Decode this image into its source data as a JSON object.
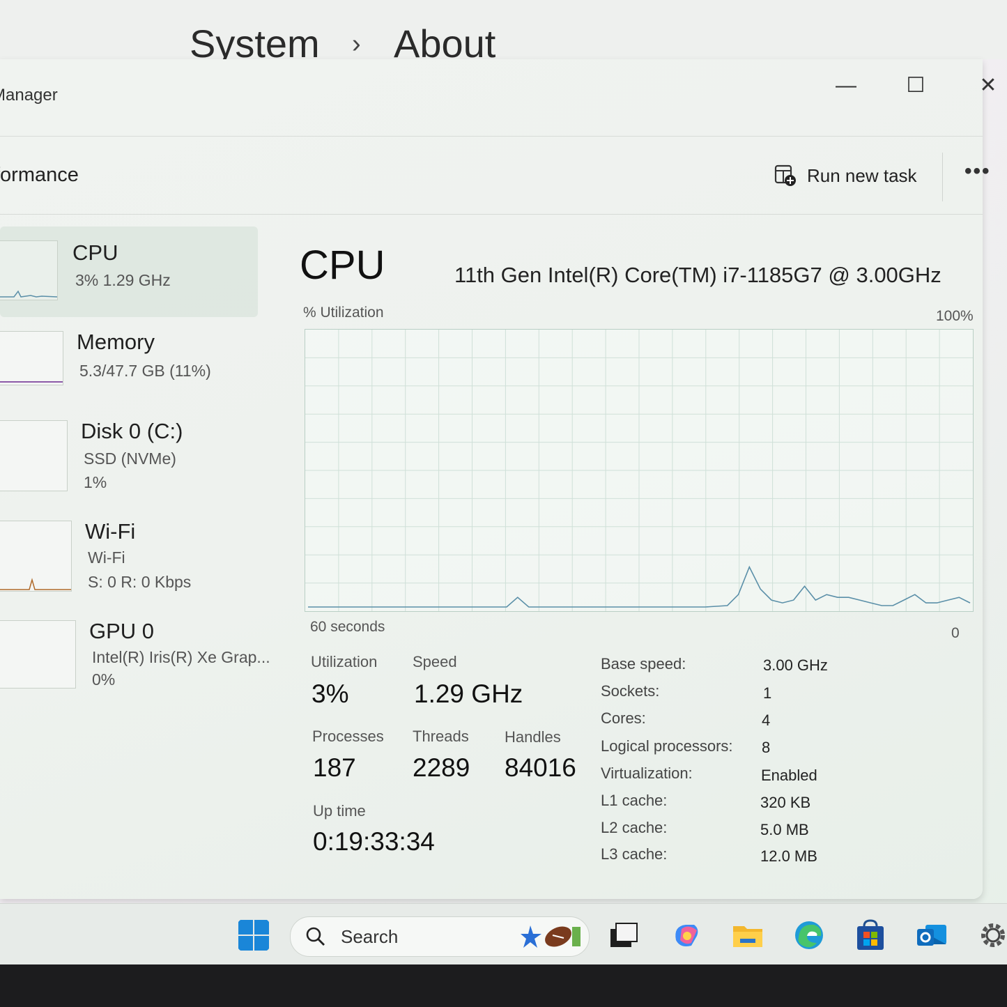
{
  "settings": {
    "breadcrumb_parent": "System",
    "breadcrumb_sep": "›",
    "breadcrumb_current": "About"
  },
  "window": {
    "title": "Manager",
    "controls": {
      "minimize": "—",
      "maximize": "☐",
      "close": "✕"
    }
  },
  "toolbar": {
    "page": "formance",
    "run_new_task": "Run new task",
    "more": "•••"
  },
  "sidebar": {
    "items": [
      {
        "name": "CPU",
        "sub1": "3%  1.29 GHz",
        "sub2": ""
      },
      {
        "name": "Memory",
        "sub1": "5.3/47.7 GB (11%)",
        "sub2": ""
      },
      {
        "name": "Disk 0 (C:)",
        "sub1": "SSD (NVMe)",
        "sub2": "1%"
      },
      {
        "name": "Wi-Fi",
        "sub1": "Wi-Fi",
        "sub2": "S: 0  R: 0 Kbps"
      },
      {
        "name": "GPU 0",
        "sub1": "Intel(R) Iris(R) Xe Grap...",
        "sub2": "0%"
      }
    ]
  },
  "main": {
    "title": "CPU",
    "model": "11th Gen Intel(R) Core(TM) i7-1185G7 @ 3.00GHz",
    "utilization_label": "% Utilization",
    "max_label": "100%",
    "time_label": "60 seconds",
    "min_label": "0"
  },
  "chart_data": {
    "type": "line",
    "ylabel": "% Utilization",
    "ylim": [
      0,
      100
    ],
    "xlabel": "60 seconds",
    "xlim": [
      60,
      0
    ],
    "grid": true,
    "series": [
      {
        "color": "#5a8fa8",
        "x": [
          60,
          56,
          52,
          48,
          44,
          42,
          41,
          40,
          38,
          36,
          34,
          32,
          30,
          28,
          26,
          24,
          22,
          21,
          20,
          19,
          18,
          17,
          16,
          15,
          14,
          13,
          12,
          11,
          10,
          9,
          8,
          7,
          6,
          5,
          4,
          3,
          2,
          1,
          0
        ],
        "values": [
          0.5,
          0.5,
          0.5,
          0.5,
          0.5,
          0.5,
          4,
          0.5,
          0.5,
          0.5,
          0.5,
          0.5,
          0.5,
          0.5,
          0.5,
          0.5,
          1,
          5,
          15,
          7,
          3,
          2,
          3,
          8,
          3,
          5,
          4,
          4,
          3,
          2,
          1,
          1,
          3,
          5,
          2,
          2,
          3,
          4,
          2
        ]
      }
    ]
  },
  "stats": {
    "utilization": {
      "label": "Utilization",
      "value": "3%"
    },
    "speed": {
      "label": "Speed",
      "value": "1.29 GHz"
    },
    "processes": {
      "label": "Processes",
      "value": "187"
    },
    "threads": {
      "label": "Threads",
      "value": "2289"
    },
    "handles": {
      "label": "Handles",
      "value": "84016"
    },
    "uptime": {
      "label": "Up time",
      "value": "0:19:33:34"
    }
  },
  "specs": [
    {
      "label": "Base speed:",
      "value": "3.00 GHz"
    },
    {
      "label": "Sockets:",
      "value": "1"
    },
    {
      "label": "Cores:",
      "value": "4"
    },
    {
      "label": "Logical processors:",
      "value": "8"
    },
    {
      "label": "Virtualization:",
      "value": "Enabled"
    },
    {
      "label": "L1 cache:",
      "value": "320 KB"
    },
    {
      "label": "L2 cache:",
      "value": "5.0 MB"
    },
    {
      "label": "L3 cache:",
      "value": "12.0 MB"
    }
  ],
  "taskbar": {
    "search_placeholder": "Search",
    "icons": [
      "windows-start-icon",
      "search-icon",
      "widgets-football-icon",
      "task-view-icon",
      "copilot-icon",
      "file-explorer-icon",
      "edge-icon",
      "store-icon",
      "outlook-icon",
      "settings-gear-icon"
    ]
  }
}
